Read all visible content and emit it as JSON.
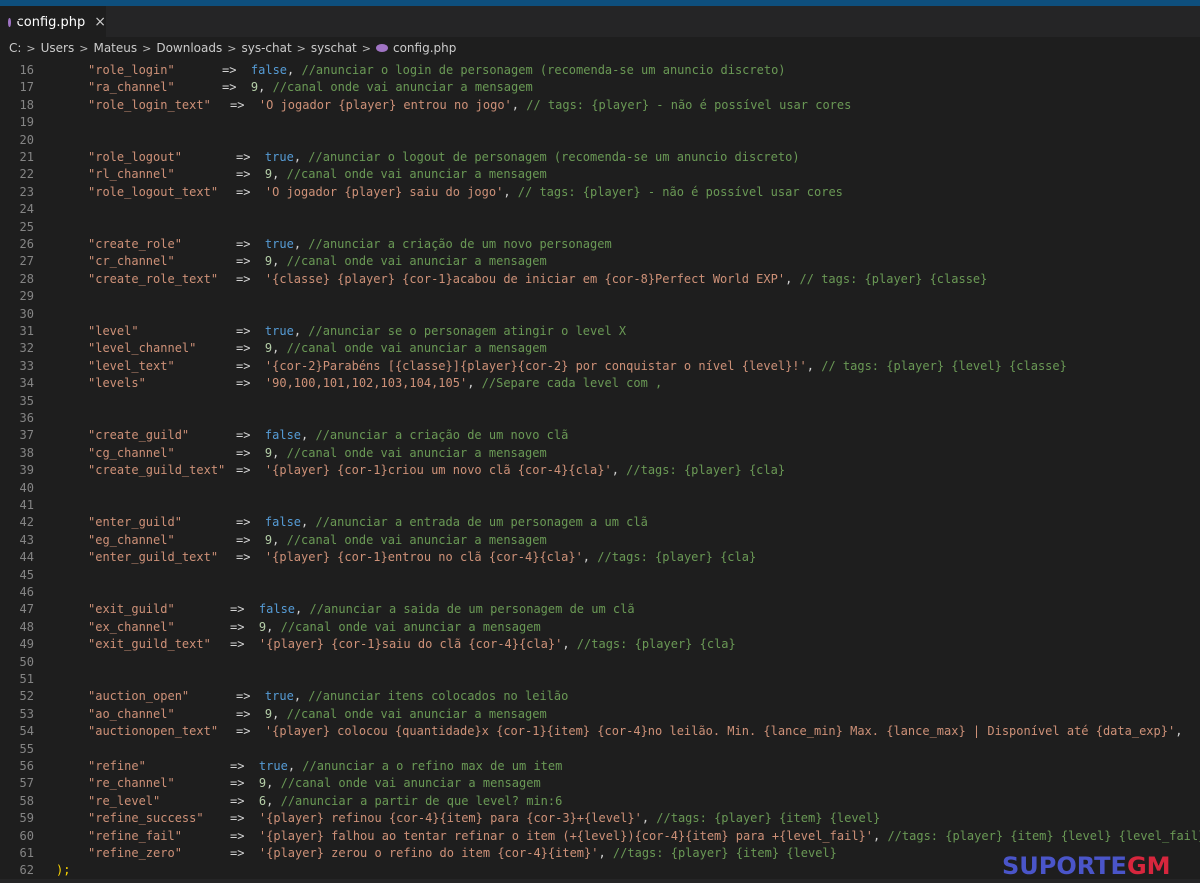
{
  "tab": {
    "title": "config.php",
    "close": "×"
  },
  "breadcrumb": [
    "C:",
    "Users",
    "Mateus",
    "Downloads",
    "sys-chat",
    "syschat",
    "config.php"
  ],
  "colors": {
    "key": "#ce9178",
    "keyword": "#569cd6",
    "number": "#b5cea8",
    "comment": "#6a9955",
    "line_number": "#858585"
  },
  "lines": [
    {
      "n": "16",
      "key": "\"role_login\"",
      "arrow": "=>",
      "val": "false",
      "vtype": "kw",
      "tail": ", ",
      "comment": "//anunciar o login de personagem (recomenda-se um anuncio discreto)",
      "rx": 222
    },
    {
      "n": "17",
      "key": "\"ra_channel\"",
      "arrow": "=>",
      "val": "9",
      "vtype": "num",
      "tail": ", ",
      "comment": "//canal onde vai anunciar a mensagem",
      "rx": 222
    },
    {
      "n": "18",
      "key": "\"role_login_text\"",
      "arrow": "=>",
      "val": "'O jogador {player} entrou no jogo'",
      "vtype": "str",
      "tail": ", ",
      "comment": "// tags: {player} - não é possível usar cores",
      "rx": 230
    },
    {
      "n": "19"
    },
    {
      "n": "20"
    },
    {
      "n": "21",
      "key": "\"role_logout\"",
      "arrow": "=>",
      "val": "true",
      "vtype": "kw",
      "tail": ", ",
      "comment": "//anunciar o logout de personagem (recomenda-se um anuncio discreto)",
      "rx": 236
    },
    {
      "n": "22",
      "key": "\"rl_channel\"",
      "arrow": "=>",
      "val": "9",
      "vtype": "num",
      "tail": ", ",
      "comment": "//canal onde vai anunciar a mensagem",
      "rx": 236
    },
    {
      "n": "23",
      "key": "\"role_logout_text\"",
      "arrow": "=>",
      "val": "'O jogador {player} saiu do jogo'",
      "vtype": "str",
      "tail": ", ",
      "comment": "// tags: {player} - não é possível usar cores",
      "rx": 236
    },
    {
      "n": "24"
    },
    {
      "n": "25"
    },
    {
      "n": "26",
      "key": "\"create_role\"",
      "arrow": "=>",
      "val": "true",
      "vtype": "kw",
      "tail": ", ",
      "comment": "//anunciar a criação de um novo personagem",
      "rx": 236
    },
    {
      "n": "27",
      "key": "\"cr_channel\"",
      "arrow": "=>",
      "val": "9",
      "vtype": "num",
      "tail": ", ",
      "comment": "//canal onde vai anunciar a mensagem",
      "rx": 236
    },
    {
      "n": "28",
      "key": "\"create_role_text\"",
      "arrow": "=>",
      "val": "'{classe} {player} {cor-1}acabou de iniciar em {cor-8}Perfect World EXP'",
      "vtype": "str",
      "tail": ", ",
      "comment": "// tags: {player} {classe}",
      "rx": 236
    },
    {
      "n": "29"
    },
    {
      "n": "30"
    },
    {
      "n": "31",
      "key": "\"level\"",
      "arrow": "=>",
      "val": "true",
      "vtype": "kw",
      "tail": ", ",
      "comment": "//anunciar se o personagem atingir o level X",
      "rx": 236
    },
    {
      "n": "32",
      "key": "\"level_channel\"",
      "arrow": "=>",
      "val": "9",
      "vtype": "num",
      "tail": ", ",
      "comment": "//canal onde vai anunciar a mensagem",
      "rx": 236
    },
    {
      "n": "33",
      "key": "\"level_text\"",
      "arrow": "=>",
      "val": "'{cor-2}Parabéns [{classe}]{player}{cor-2} por conquistar o nível {level}!'",
      "vtype": "str",
      "tail": ", ",
      "comment": "// tags: {player} {level} {classe}",
      "rx": 236
    },
    {
      "n": "34",
      "key": "\"levels\"",
      "arrow": "=>",
      "val": "'90,100,101,102,103,104,105'",
      "vtype": "str",
      "tail": ", ",
      "comment": "//Separe cada level com ,",
      "rx": 236
    },
    {
      "n": "35"
    },
    {
      "n": "36"
    },
    {
      "n": "37",
      "key": "\"create_guild\"",
      "arrow": "=>",
      "val": "false",
      "vtype": "kw",
      "tail": ", ",
      "comment": "//anunciar a criação de um novo clã",
      "rx": 236
    },
    {
      "n": "38",
      "key": "\"cg_channel\"",
      "arrow": "=>",
      "val": "9",
      "vtype": "num",
      "tail": ", ",
      "comment": "//canal onde vai anunciar a mensagem",
      "rx": 236
    },
    {
      "n": "39",
      "key": "\"create_guild_text\"",
      "arrow": "=>",
      "val": "'{player} {cor-1}criou um novo clã {cor-4}{cla}'",
      "vtype": "str",
      "tail": ", ",
      "comment": "//tags: {player} {cla}",
      "rx": 236
    },
    {
      "n": "40"
    },
    {
      "n": "41"
    },
    {
      "n": "42",
      "key": "\"enter_guild\"",
      "arrow": "=>",
      "val": "false",
      "vtype": "kw",
      "tail": ", ",
      "comment": "//anunciar a entrada de um personagem a um clã",
      "rx": 236
    },
    {
      "n": "43",
      "key": "\"eg_channel\"",
      "arrow": "=>",
      "val": "9",
      "vtype": "num",
      "tail": ", ",
      "comment": "//canal onde vai anunciar a mensagem",
      "rx": 236
    },
    {
      "n": "44",
      "key": "\"enter_guild_text\"",
      "arrow": "=>",
      "val": "'{player} {cor-1}entrou no clã {cor-4}{cla}'",
      "vtype": "str",
      "tail": ", ",
      "comment": "//tags: {player} {cla}",
      "rx": 236
    },
    {
      "n": "45"
    },
    {
      "n": "46"
    },
    {
      "n": "47",
      "key": "\"exit_guild\"",
      "arrow": "=>",
      "val": "false",
      "vtype": "kw",
      "tail": ", ",
      "comment": "//anunciar a saida de um personagem de um clã",
      "rx": 230
    },
    {
      "n": "48",
      "key": "\"ex_channel\"",
      "arrow": "=>",
      "val": "9",
      "vtype": "num",
      "tail": ", ",
      "comment": "//canal onde vai anunciar a mensagem",
      "rx": 230
    },
    {
      "n": "49",
      "key": "\"exit_guild_text\"",
      "arrow": "=>",
      "val": "'{player} {cor-1}saiu do clã {cor-4}{cla}'",
      "vtype": "str",
      "tail": ", ",
      "comment": "//tags: {player} {cla}",
      "rx": 230
    },
    {
      "n": "50"
    },
    {
      "n": "51"
    },
    {
      "n": "52",
      "key": "\"auction_open\"",
      "arrow": "=>",
      "val": "true",
      "vtype": "kw",
      "tail": ", ",
      "comment": "//anunciar itens colocados no leilão",
      "rx": 236
    },
    {
      "n": "53",
      "key": "\"ao_channel\"",
      "arrow": "=>",
      "val": "9",
      "vtype": "num",
      "tail": ", ",
      "comment": "//canal onde vai anunciar a mensagem",
      "rx": 236
    },
    {
      "n": "54",
      "key": "\"auctionopen_text\"",
      "arrow": "=>",
      "val": "'{player} colocou {quantidade}x {cor-1}{item} {cor-4}no leilão. Min. {lance_min} Max. {lance_max} | Disponível até {data_exp}'",
      "vtype": "str",
      "tail": ",",
      "comment": "",
      "rx": 236
    },
    {
      "n": "55"
    },
    {
      "n": "56",
      "key": "\"refine\"",
      "arrow": "=>",
      "val": "true",
      "vtype": "kw",
      "tail": ", ",
      "comment": "//anunciar a o refino max de um item",
      "rx": 230
    },
    {
      "n": "57",
      "key": "\"re_channel\"",
      "arrow": "=>",
      "val": "9",
      "vtype": "num",
      "tail": ", ",
      "comment": "//canal onde vai anunciar a mensagem",
      "rx": 230
    },
    {
      "n": "58",
      "key": "\"re_level\"",
      "arrow": "=>",
      "val": "6",
      "vtype": "num",
      "tail": ", ",
      "comment": "//anunciar a partir de que level? min:6",
      "rx": 230
    },
    {
      "n": "59",
      "key": "\"refine_success\"",
      "arrow": "=>",
      "val": "'{player} refinou {cor-4}{item} para {cor-3}+{level}'",
      "vtype": "str",
      "tail": ", ",
      "comment": "//tags: {player} {item} {level}",
      "rx": 230
    },
    {
      "n": "60",
      "key": "\"refine_fail\"",
      "arrow": "=>",
      "val": "'{player} falhou ao tentar refinar o item (+{level}){cor-4}{item} para +{level_fail}'",
      "vtype": "str",
      "tail": ", ",
      "comment": "//tags: {player} {item} {level} {level_fail}",
      "rx": 230
    },
    {
      "n": "61",
      "key": "\"refine_zero\"",
      "arrow": "=>",
      "val": "'{player} zerou o refino do item {cor-4}{item}'",
      "vtype": "str",
      "tail": ", ",
      "comment": "//tags: {player} {item} {level}",
      "rx": 230
    },
    {
      "n": "62",
      "closing": ");"
    }
  ],
  "watermark": {
    "part1": "SUPORTE",
    "part2": "GM"
  }
}
